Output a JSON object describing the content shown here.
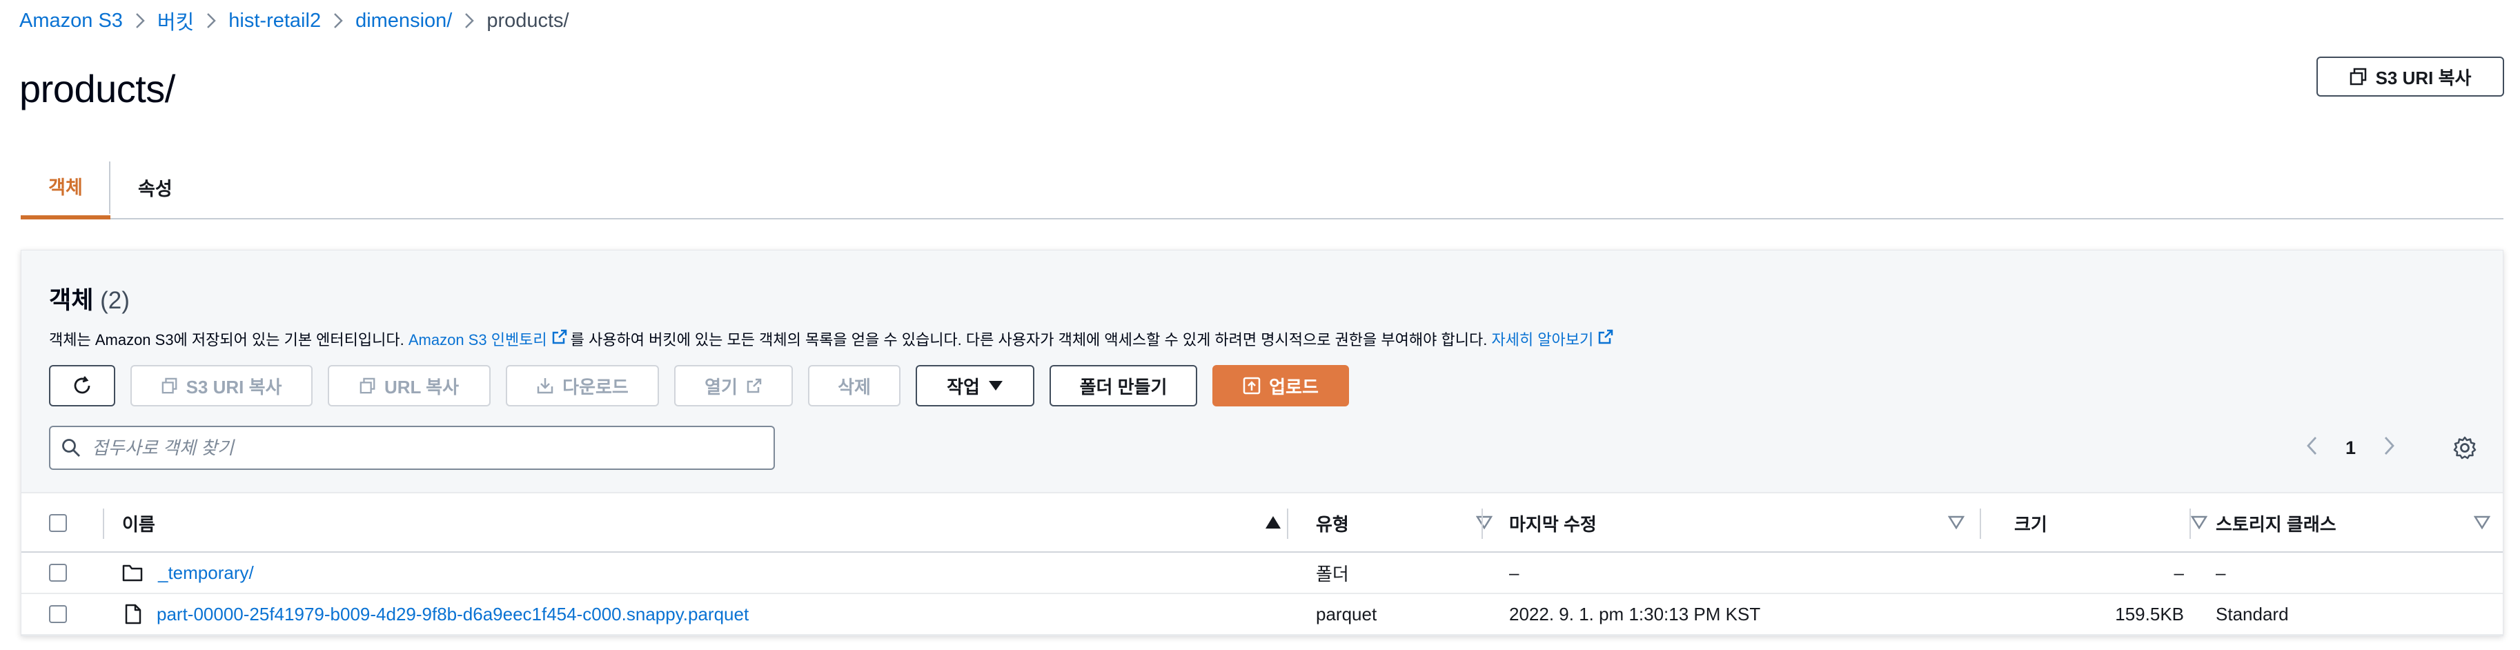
{
  "breadcrumb": {
    "items": [
      "Amazon S3",
      "버킷",
      "hist-retail2",
      "dimension/",
      "products/"
    ]
  },
  "page": {
    "title": "products/",
    "copy_uri_label": "S3 URI 복사"
  },
  "tabs": [
    {
      "label": "객체",
      "active": true
    },
    {
      "label": "속성",
      "active": false
    }
  ],
  "objects_panel": {
    "title": "객체",
    "count": "(2)",
    "description": {
      "part1": "객체는 Amazon S3에 저장되어 있는 기본 엔터티입니다.",
      "inventory_link": "Amazon S3 인벤토리",
      "part2": "를 사용하여 버킷에 있는 모든 객체의 목록을 얻을 수 있습니다. 다른 사용자가 객체에 액세스할 수 있게 하려면 명시적으로 권한을 부여해야 합니다.",
      "learn_more_link": "자세히 알아보기"
    },
    "toolbar": {
      "copy_s3_uri": "S3 URI 복사",
      "copy_url": "URL 복사",
      "download": "다운로드",
      "open": "열기",
      "delete": "삭제",
      "actions": "작업",
      "create_folder": "폴더 만들기",
      "upload": "업로드"
    },
    "search": {
      "placeholder": "접두사로 객체 찾기",
      "value": ""
    },
    "pagination": {
      "current_page": "1"
    }
  },
  "table": {
    "columns": [
      "이름",
      "유형",
      "마지막 수정",
      "크기",
      "스토리지 클래스"
    ],
    "rows": [
      {
        "name": "_temporary/",
        "icon": "folder-icon",
        "type": "폴더",
        "last_modified": "–",
        "size": "–",
        "storage_class": "–"
      },
      {
        "name": "part-00000-25f41979-b009-4d29-9f8b-d6a9eec1f454-c000.snappy.parquet",
        "icon": "file-icon",
        "type": "parquet",
        "last_modified": "2022. 9. 1. pm 1:30:13 PM KST",
        "size": "159.5KB",
        "storage_class": "Standard"
      }
    ]
  },
  "colors": {
    "link": "#0972d3",
    "primary": "#e07941",
    "active_tab": "#d0702d",
    "text": "#16191f"
  }
}
